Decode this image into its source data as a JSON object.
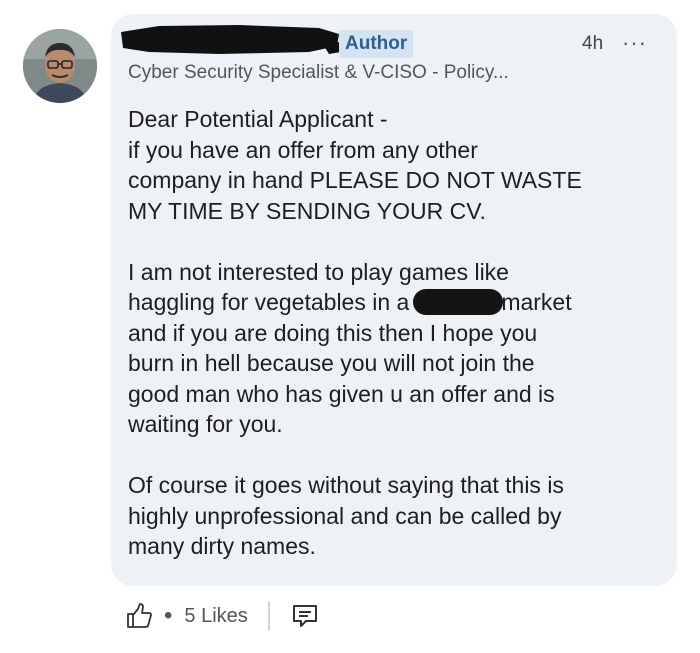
{
  "comment": {
    "author_badge": "Author",
    "timestamp": "4h",
    "more_icon": "more-horizontal-icon",
    "headline": "Cyber Security Specialist & V-CISO - Policy...",
    "paragraph1_lines": [
      "Dear Potential Applicant -",
      "if you have an offer from any other",
      "company in hand PLEASE DO NOT WASTE",
      "MY TIME BY SENDING YOUR CV."
    ],
    "paragraph2_lines": [
      "I am not interested to play games like",
      "haggling for vegetables in a",
      "market",
      "and if you are doing this then I hope you",
      "burn in hell because you will not join the",
      "good man who has given u an offer and is",
      "waiting for you."
    ],
    "paragraph3_lines": [
      "Of course it goes without saying that this is",
      "highly unprofessional and can be called by",
      "many dirty names."
    ]
  },
  "actions": {
    "like_icon": "thumbs-up-icon",
    "separator_dot": "•",
    "likes_label": "5 Likes",
    "reply_icon": "reply-comment-icon"
  }
}
